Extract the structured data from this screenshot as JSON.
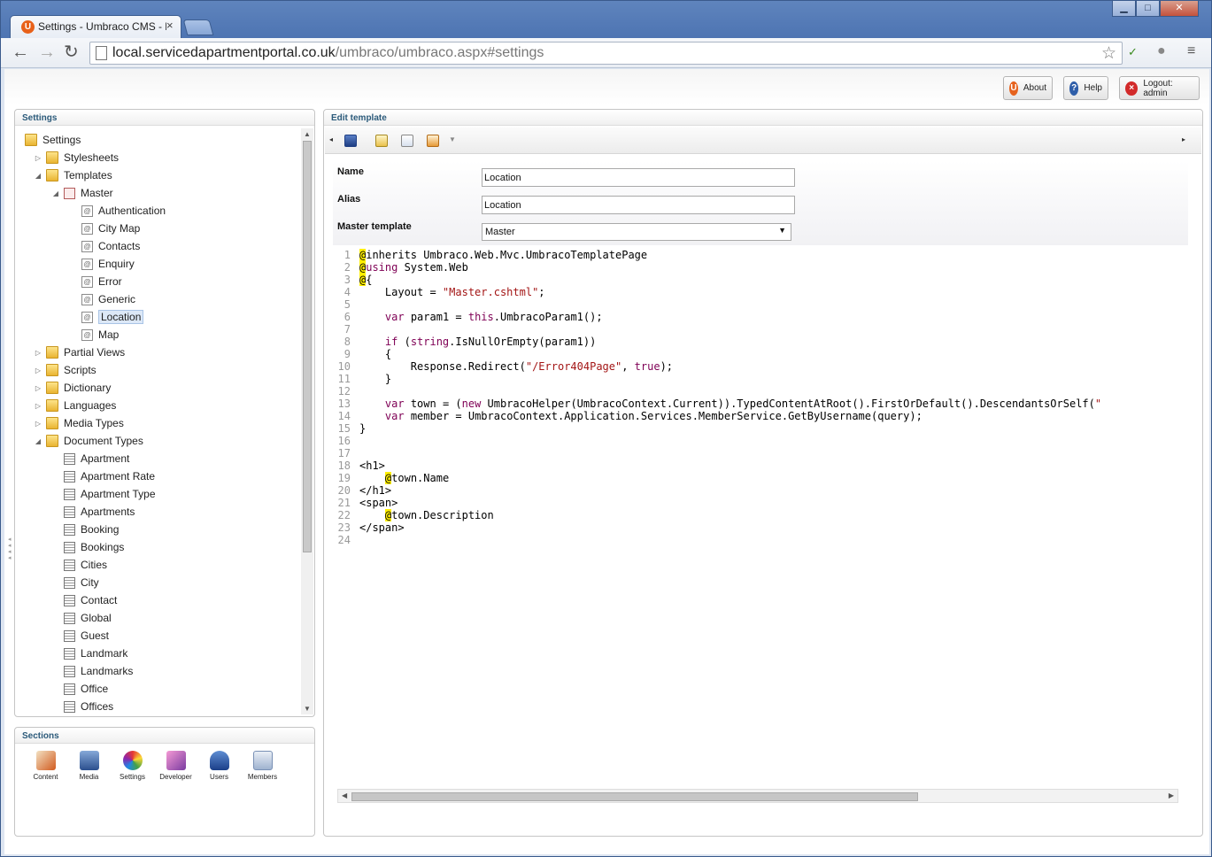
{
  "browser": {
    "tab_title": "Settings - Umbraco CMS - loc",
    "tab_close": "×",
    "url_host": "local.servicedapartmentportal.co.uk",
    "url_path": "/umbraco/umbraco.aspx#settings",
    "window_controls": {
      "minimize": "▁",
      "maximize": "□",
      "close": "✕"
    }
  },
  "header": {
    "about_label": "About",
    "help_label": "Help",
    "logout_label": "Logout: admin"
  },
  "tree_panel": {
    "title": "Settings",
    "nodes": [
      {
        "label": "Settings",
        "level": 0,
        "type": "folder",
        "arrow": ""
      },
      {
        "label": "Stylesheets",
        "level": 1,
        "type": "folder",
        "arrow": "▷"
      },
      {
        "label": "Templates",
        "level": 1,
        "type": "folder",
        "arrow": "◢"
      },
      {
        "label": "Master",
        "level": 2,
        "type": "master",
        "arrow": "◢"
      },
      {
        "label": "Authentication",
        "level": 3,
        "type": "template",
        "arrow": ""
      },
      {
        "label": "City Map",
        "level": 3,
        "type": "template",
        "arrow": ""
      },
      {
        "label": "Contacts",
        "level": 3,
        "type": "template",
        "arrow": ""
      },
      {
        "label": "Enquiry",
        "level": 3,
        "type": "template",
        "arrow": ""
      },
      {
        "label": "Error",
        "level": 3,
        "type": "template",
        "arrow": ""
      },
      {
        "label": "Generic",
        "level": 3,
        "type": "template",
        "arrow": ""
      },
      {
        "label": "Location",
        "level": 3,
        "type": "template",
        "arrow": "",
        "selected": true
      },
      {
        "label": "Map",
        "level": 3,
        "type": "template",
        "arrow": ""
      },
      {
        "label": "Partial Views",
        "level": 1,
        "type": "folder",
        "arrow": "▷"
      },
      {
        "label": "Scripts",
        "level": 1,
        "type": "folder",
        "arrow": "▷"
      },
      {
        "label": "Dictionary",
        "level": 1,
        "type": "folder",
        "arrow": "▷"
      },
      {
        "label": "Languages",
        "level": 1,
        "type": "folder",
        "arrow": "▷"
      },
      {
        "label": "Media Types",
        "level": 1,
        "type": "folder",
        "arrow": "▷"
      },
      {
        "label": "Document Types",
        "level": 1,
        "type": "folder",
        "arrow": "◢"
      },
      {
        "label": "Apartment",
        "level": 2,
        "type": "doctype",
        "arrow": ""
      },
      {
        "label": "Apartment Rate",
        "level": 2,
        "type": "doctype",
        "arrow": ""
      },
      {
        "label": "Apartment Type",
        "level": 2,
        "type": "doctype",
        "arrow": ""
      },
      {
        "label": "Apartments",
        "level": 2,
        "type": "doctype",
        "arrow": ""
      },
      {
        "label": "Booking",
        "level": 2,
        "type": "doctype",
        "arrow": ""
      },
      {
        "label": "Bookings",
        "level": 2,
        "type": "doctype",
        "arrow": ""
      },
      {
        "label": "Cities",
        "level": 2,
        "type": "doctype",
        "arrow": ""
      },
      {
        "label": "City",
        "level": 2,
        "type": "doctype",
        "arrow": ""
      },
      {
        "label": "Contact",
        "level": 2,
        "type": "doctype",
        "arrow": ""
      },
      {
        "label": "Global",
        "level": 2,
        "type": "doctype",
        "arrow": ""
      },
      {
        "label": "Guest",
        "level": 2,
        "type": "doctype",
        "arrow": ""
      },
      {
        "label": "Landmark",
        "level": 2,
        "type": "doctype",
        "arrow": ""
      },
      {
        "label": "Landmarks",
        "level": 2,
        "type": "doctype",
        "arrow": ""
      },
      {
        "label": "Office",
        "level": 2,
        "type": "doctype",
        "arrow": ""
      },
      {
        "label": "Offices",
        "level": 2,
        "type": "doctype",
        "arrow": ""
      }
    ]
  },
  "sections_panel": {
    "title": "Sections",
    "items": [
      {
        "id": "content",
        "label": "Content",
        "icon": "content-icon"
      },
      {
        "id": "media",
        "label": "Media",
        "icon": "media-icon"
      },
      {
        "id": "settings",
        "label": "Settings",
        "icon": "settings-icon"
      },
      {
        "id": "developer",
        "label": "Developer",
        "icon": "developer-icon"
      },
      {
        "id": "users",
        "label": "Users",
        "icon": "users-icon"
      },
      {
        "id": "members",
        "label": "Members",
        "icon": "members-icon"
      }
    ]
  },
  "edit_panel": {
    "title": "Edit template",
    "name_label": "Name",
    "name_value": "Location",
    "alias_label": "Alias",
    "alias_value": "Location",
    "master_label": "Master template",
    "master_value": "Master",
    "code_lines": [
      [
        {
          "t": "@",
          "c": "at"
        },
        {
          "t": "inherits Umbraco.Web.Mvc.UmbracoTemplatePage"
        }
      ],
      [
        {
          "t": "@",
          "c": "at"
        },
        {
          "t": "using",
          "c": "kw"
        },
        {
          "t": " System.Web"
        }
      ],
      [
        {
          "t": "@",
          "c": "at"
        },
        {
          "t": "{"
        }
      ],
      [
        {
          "t": "    Layout = "
        },
        {
          "t": "\"Master.cshtml\"",
          "c": "str"
        },
        {
          "t": ";"
        }
      ],
      [],
      [
        {
          "t": "    "
        },
        {
          "t": "var",
          "c": "kw"
        },
        {
          "t": " param1 = "
        },
        {
          "t": "this",
          "c": "kw"
        },
        {
          "t": ".UmbracoParam1();"
        }
      ],
      [],
      [
        {
          "t": "    "
        },
        {
          "t": "if",
          "c": "kw"
        },
        {
          "t": " ("
        },
        {
          "t": "string",
          "c": "kw"
        },
        {
          "t": ".IsNullOrEmpty(param1))"
        }
      ],
      [
        {
          "t": "    {"
        }
      ],
      [
        {
          "t": "        Response.Redirect("
        },
        {
          "t": "\"/Error404Page\"",
          "c": "str"
        },
        {
          "t": ", "
        },
        {
          "t": "true",
          "c": "kw"
        },
        {
          "t": ");"
        }
      ],
      [
        {
          "t": "    }"
        }
      ],
      [],
      [
        {
          "t": "    "
        },
        {
          "t": "var",
          "c": "kw"
        },
        {
          "t": " town = ("
        },
        {
          "t": "new",
          "c": "kw"
        },
        {
          "t": " UmbracoHelper(UmbracoContext.Current)).TypedContentAtRoot().FirstOrDefault().DescendantsOrSelf("
        },
        {
          "t": "\"",
          "c": "str"
        }
      ],
      [
        {
          "t": "    "
        },
        {
          "t": "var",
          "c": "kw"
        },
        {
          "t": " member = UmbracoContext.Application.Services.MemberService.GetByUsername(query);"
        }
      ],
      [
        {
          "t": "}"
        }
      ],
      [],
      [],
      [
        {
          "t": "<h1>"
        }
      ],
      [
        {
          "t": "    "
        },
        {
          "t": "@",
          "c": "at"
        },
        {
          "t": "town.Name"
        }
      ],
      [
        {
          "t": "</h1>"
        }
      ],
      [
        {
          "t": "<span>"
        }
      ],
      [
        {
          "t": "    "
        },
        {
          "t": "@",
          "c": "at"
        },
        {
          "t": "town.Description"
        }
      ],
      [
        {
          "t": "</span>"
        }
      ],
      []
    ]
  },
  "colors": {
    "keyword": "#7f0055",
    "string": "#a31515",
    "razor_highlight": "#ffef00",
    "panel_title": "#2b5a7a"
  }
}
